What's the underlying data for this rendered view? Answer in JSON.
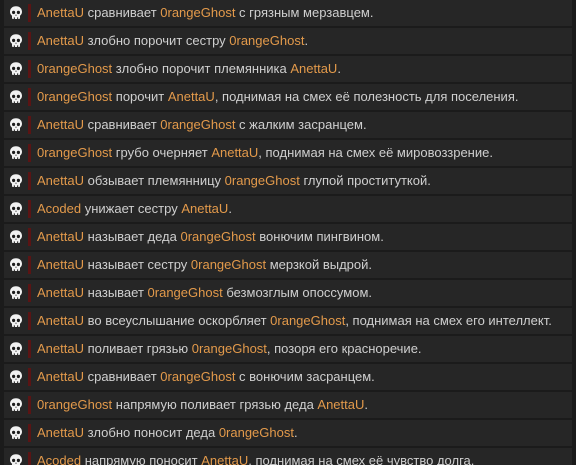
{
  "colors": {
    "background": "#1b1b1b",
    "row_background": "#262626",
    "name": "#e39a4b",
    "text": "#cfcfcf",
    "accent": "#5a1414"
  },
  "messages": [
    {
      "icon": "skull-icon",
      "parts": [
        {
          "t": "AnettaU",
          "n": true
        },
        {
          "t": " сравнивает "
        },
        {
          "t": "0rangeGhost",
          "n": true
        },
        {
          "t": " с грязным мерзавцем."
        }
      ]
    },
    {
      "icon": "skull-icon",
      "parts": [
        {
          "t": "AnettaU",
          "n": true
        },
        {
          "t": " злобно порочит сестру "
        },
        {
          "t": "0rangeGhost",
          "n": true
        },
        {
          "t": "."
        }
      ]
    },
    {
      "icon": "skull-icon",
      "parts": [
        {
          "t": "0rangeGhost",
          "n": true
        },
        {
          "t": " злобно порочит племянника "
        },
        {
          "t": "AnettaU",
          "n": true
        },
        {
          "t": "."
        }
      ]
    },
    {
      "icon": "skull-icon",
      "parts": [
        {
          "t": "0rangeGhost",
          "n": true
        },
        {
          "t": " порочит "
        },
        {
          "t": "AnettaU",
          "n": true
        },
        {
          "t": ", поднимая на смех её полезность для поселения."
        }
      ]
    },
    {
      "icon": "skull-icon",
      "parts": [
        {
          "t": "AnettaU",
          "n": true
        },
        {
          "t": " сравнивает "
        },
        {
          "t": "0rangeGhost",
          "n": true
        },
        {
          "t": " с жалким засранцем."
        }
      ]
    },
    {
      "icon": "skull-icon",
      "parts": [
        {
          "t": "0rangeGhost",
          "n": true
        },
        {
          "t": " грубо очерняет "
        },
        {
          "t": "AnettaU",
          "n": true
        },
        {
          "t": ", поднимая на смех её мировоззрение."
        }
      ]
    },
    {
      "icon": "skull-icon",
      "parts": [
        {
          "t": "AnettaU",
          "n": true
        },
        {
          "t": " обзывает племянницу "
        },
        {
          "t": "0rangeGhost",
          "n": true
        },
        {
          "t": " глупой проституткой."
        }
      ]
    },
    {
      "icon": "skull-icon",
      "parts": [
        {
          "t": "Acoded",
          "n": true
        },
        {
          "t": " унижает сестру "
        },
        {
          "t": "AnettaU",
          "n": true
        },
        {
          "t": "."
        }
      ]
    },
    {
      "icon": "skull-icon",
      "parts": [
        {
          "t": "AnettaU",
          "n": true
        },
        {
          "t": " называет деда "
        },
        {
          "t": "0rangeGhost",
          "n": true
        },
        {
          "t": " вонючим пингвином."
        }
      ]
    },
    {
      "icon": "skull-icon",
      "parts": [
        {
          "t": "AnettaU",
          "n": true
        },
        {
          "t": " называет сестру "
        },
        {
          "t": "0rangeGhost",
          "n": true
        },
        {
          "t": " мерзкой выдрой."
        }
      ]
    },
    {
      "icon": "skull-icon",
      "parts": [
        {
          "t": "AnettaU",
          "n": true
        },
        {
          "t": " называет "
        },
        {
          "t": "0rangeGhost",
          "n": true
        },
        {
          "t": " безмозглым опоссумом."
        }
      ]
    },
    {
      "icon": "skull-icon",
      "parts": [
        {
          "t": "AnettaU",
          "n": true
        },
        {
          "t": " во всеуслышание оскорбляет "
        },
        {
          "t": "0rangeGhost",
          "n": true
        },
        {
          "t": ", поднимая на смех его интеллект."
        }
      ]
    },
    {
      "icon": "skull-icon",
      "parts": [
        {
          "t": "AnettaU",
          "n": true
        },
        {
          "t": " поливает грязью "
        },
        {
          "t": "0rangeGhost",
          "n": true
        },
        {
          "t": ", позоря его красноречие."
        }
      ]
    },
    {
      "icon": "skull-icon",
      "parts": [
        {
          "t": "AnettaU",
          "n": true
        },
        {
          "t": " сравнивает "
        },
        {
          "t": "0rangeGhost",
          "n": true
        },
        {
          "t": " с вонючим засранцем."
        }
      ]
    },
    {
      "icon": "skull-icon",
      "parts": [
        {
          "t": "0rangeGhost",
          "n": true
        },
        {
          "t": " напрямую поливает грязью деда "
        },
        {
          "t": "AnettaU",
          "n": true
        },
        {
          "t": "."
        }
      ]
    },
    {
      "icon": "skull-icon",
      "parts": [
        {
          "t": "AnettaU",
          "n": true
        },
        {
          "t": " злобно поносит деда "
        },
        {
          "t": "0rangeGhost",
          "n": true
        },
        {
          "t": "."
        }
      ]
    },
    {
      "icon": "skull-icon",
      "parts": [
        {
          "t": "Acoded",
          "n": true
        },
        {
          "t": " напрямую поносит "
        },
        {
          "t": "AnettaU",
          "n": true
        },
        {
          "t": ", поднимая на смех её чувство долга."
        }
      ]
    }
  ]
}
